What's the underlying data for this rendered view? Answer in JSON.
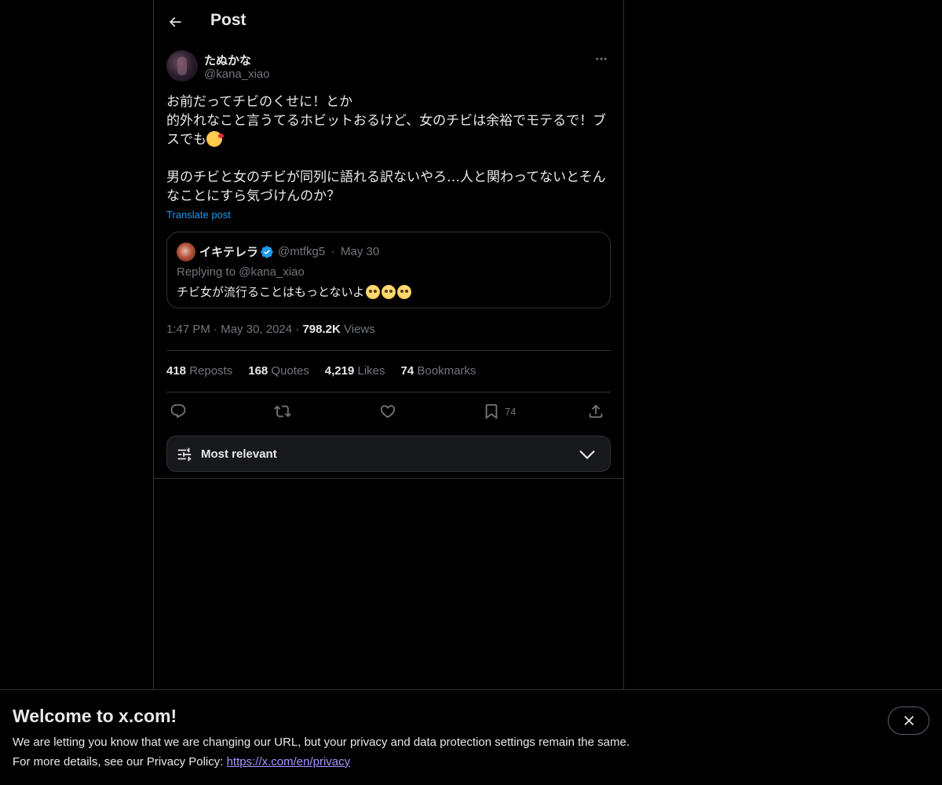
{
  "header": {
    "title": "Post"
  },
  "author": {
    "display_name": "たぬかな",
    "handle": "@kana_xiao"
  },
  "tweet": {
    "line1": "お前だってチビのくせに！とか",
    "line2": "的外れなこと言うてるホビットおるけど、女のチビは余裕でモテるで！ブ",
    "line3": "スでも",
    "line4": "男のチビと女のチビが同列に語れる訳ないやろ…人と関わってないとそん",
    "line5": "なことにすら気づけんのか？",
    "translate_label": "Translate post"
  },
  "quote": {
    "display_name": "イキテレラ",
    "handle": "@mtfkg5",
    "dot": "·",
    "date": "May 30",
    "replying_prefix": "Replying to ",
    "replying_handle": "@kana_xiao",
    "text": "チビ女が流行ることはもっとないよ"
  },
  "meta": {
    "time": "1:47 PM",
    "sep1": " · ",
    "date": "May 30, 2024",
    "sep2": " · ",
    "views_count": "798.2K",
    "views_label": " Views"
  },
  "stats": [
    {
      "count": "418",
      "label": " Reposts"
    },
    {
      "count": "168",
      "label": " Quotes"
    },
    {
      "count": "4,219",
      "label": " Likes"
    },
    {
      "count": "74",
      "label": " Bookmarks"
    }
  ],
  "actions": {
    "bookmark_count": "74"
  },
  "sort": {
    "label": "Most relevant"
  },
  "banner": {
    "title": "Welcome to x.com!",
    "line1": "We are letting you know that we are changing our URL, but your privacy and data protection settings remain the same.",
    "line2_prefix": "For more details, see our Privacy Policy: ",
    "link": "https://x.com/en/privacy"
  },
  "colors": {
    "accent": "#1d9bf0",
    "link_purple": "#a994ff",
    "border": "#2f3336",
    "muted": "#71767b"
  }
}
